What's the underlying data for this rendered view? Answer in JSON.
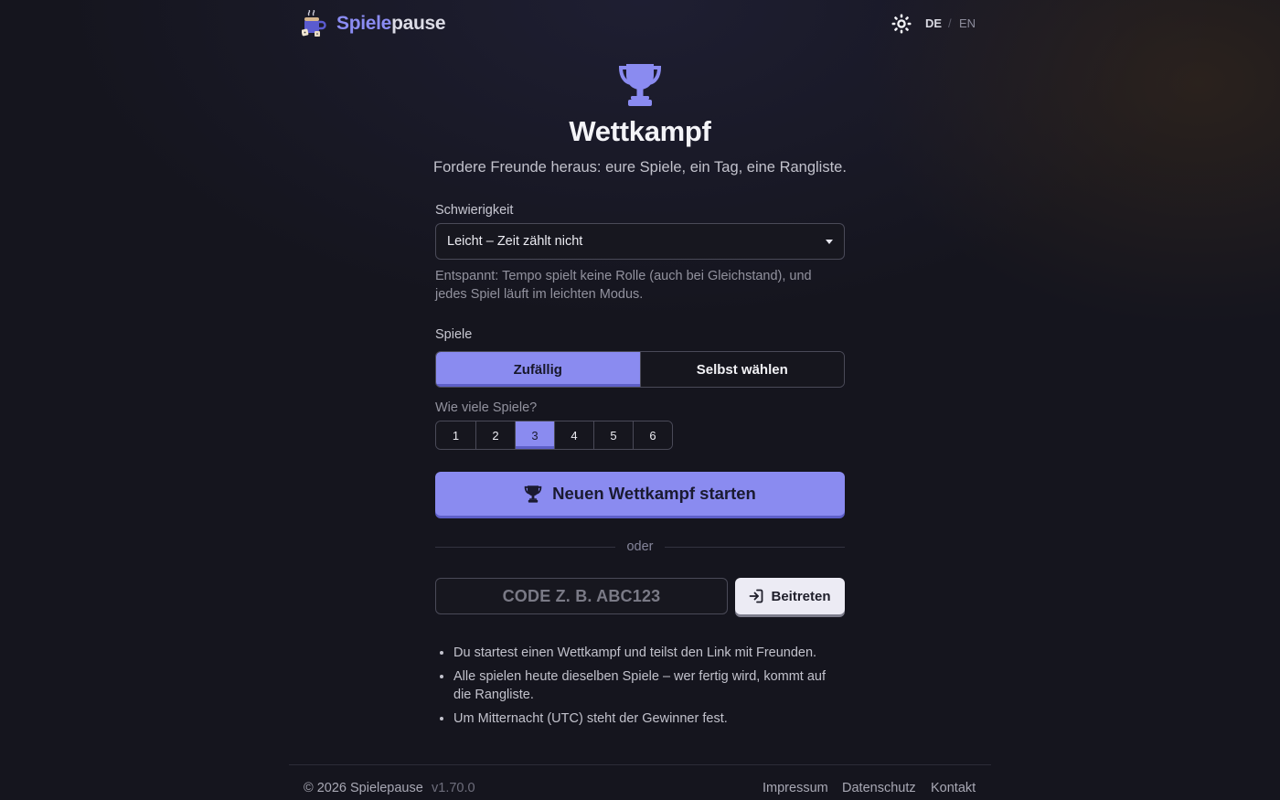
{
  "header": {
    "brand_part1": "Spiele",
    "brand_part2": "pause",
    "lang_de": "DE",
    "lang_separator": "/",
    "lang_en": "EN"
  },
  "hero": {
    "title": "Wettkampf",
    "subtitle": "Fordere Freunde heraus: eure Spiele, ein Tag, eine Rangliste."
  },
  "form": {
    "difficulty_label": "Schwierigkeit",
    "difficulty_value": "Leicht – Zeit zählt nicht",
    "difficulty_hint": "Entspannt: Tempo spielt keine Rolle (auch bei Gleichstand), und jedes Spiel läuft im leichten Modus.",
    "games_label": "Spiele",
    "mode_random": "Zufällig",
    "mode_choose": "Selbst wählen",
    "selected_mode": "Zufällig",
    "count_label": "Wie viele Spiele?",
    "counts": [
      "1",
      "2",
      "3",
      "4",
      "5",
      "6"
    ],
    "selected_count": "3",
    "start_button": "Neuen Wettkampf starten",
    "divider_text": "oder",
    "code_placeholder": "CODE Z. B. ABC123",
    "join_button": "Beitreten"
  },
  "rules": [
    "Du startest einen Wettkampf und teilst den Link mit Freunden.",
    "Alle spielen heute dieselben Spiele – wer fertig wird, kommt auf die Rangliste.",
    "Um Mitternacht (UTC) steht der Gewinner fest."
  ],
  "footer": {
    "copyright": "© 2026 Spielepause",
    "version": "v1.70.0",
    "links": [
      "Impressum",
      "Datenschutz",
      "Kontakt"
    ]
  },
  "colors": {
    "accent": "#8a8bf0",
    "accent_shadow": "#5d5fc8",
    "background": "#15151e"
  },
  "icons": {
    "logo": "coffee-mug-dice-icon",
    "theme": "sun-icon",
    "hero": "trophy-icon",
    "start": "trophy-icon",
    "join": "sign-in-icon",
    "select": "caret-down-icon"
  }
}
